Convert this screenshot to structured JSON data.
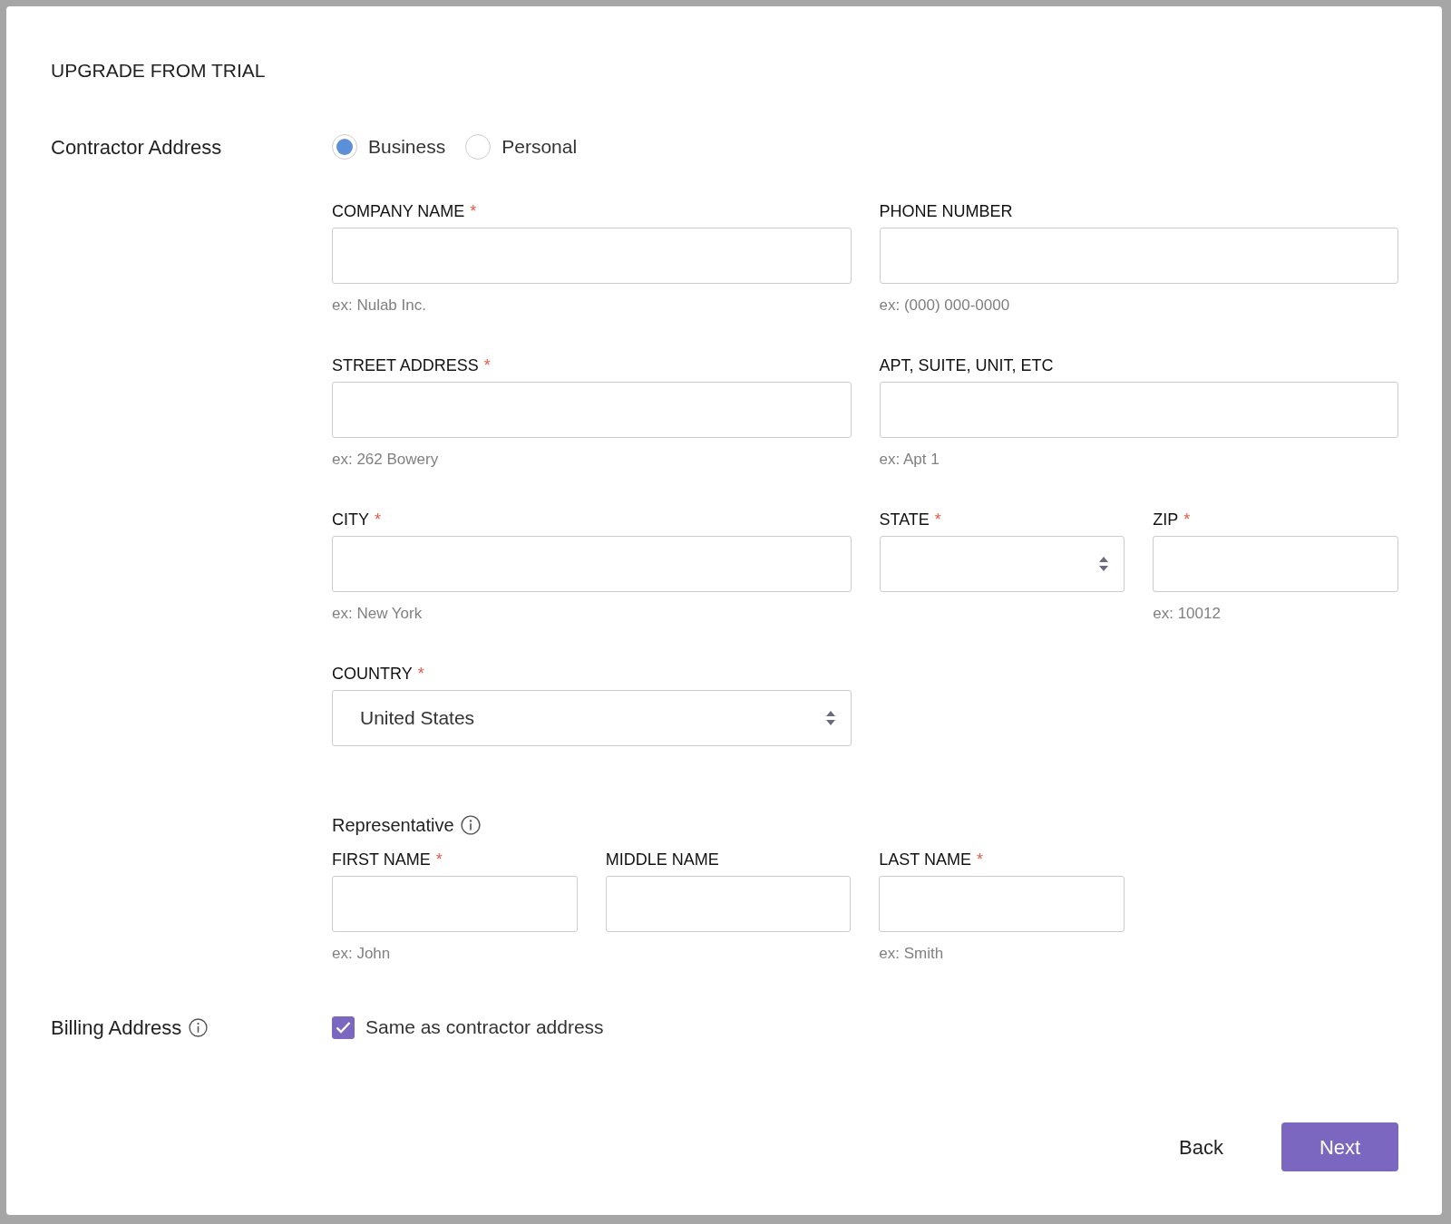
{
  "title": "UPGRADE FROM TRIAL",
  "contractor": {
    "label": "Contractor Address",
    "options": [
      {
        "label": "Business",
        "selected": true
      },
      {
        "label": "Personal",
        "selected": false
      }
    ]
  },
  "address_rows": [
    [
      {
        "label": "COMPANY NAME",
        "required_mark": "*",
        "kind": "text",
        "hint": "ex: Nulab Inc."
      },
      {
        "label": "PHONE NUMBER",
        "kind": "text",
        "hint": "ex: (000) 000-0000"
      }
    ],
    [
      {
        "label": "STREET ADDRESS",
        "required_mark": "*",
        "kind": "text",
        "hint": "ex: 262 Bowery"
      },
      {
        "label": "APT, SUITE, UNIT, ETC",
        "kind": "text",
        "hint": "ex: Apt 1"
      }
    ],
    [
      {
        "label": "CITY",
        "required_mark": "*",
        "kind": "text",
        "hint": "ex: New York"
      },
      {
        "label": "STATE",
        "required_mark": "*",
        "kind": "select"
      },
      {
        "label": "ZIP",
        "required_mark": "*",
        "kind": "text",
        "hint": "ex: 10012"
      }
    ],
    [
      {
        "label": "COUNTRY",
        "required_mark": "*",
        "kind": "select",
        "value": "United States"
      }
    ]
  ],
  "representative": {
    "label": "Representative",
    "fields": [
      {
        "label": "FIRST NAME",
        "required_mark": "*",
        "kind": "text",
        "hint": "ex: John"
      },
      {
        "label": "MIDDLE NAME",
        "kind": "text"
      },
      {
        "label": "LAST NAME",
        "required_mark": "*",
        "kind": "text",
        "hint": "ex: Smith"
      }
    ]
  },
  "billing": {
    "label": "Billing Address",
    "checkbox": {
      "label": "Same as contractor address",
      "checked": true
    }
  },
  "buttons": [
    {
      "label": "Back",
      "kind": "link"
    },
    {
      "label": "Next",
      "kind": "primary"
    }
  ]
}
